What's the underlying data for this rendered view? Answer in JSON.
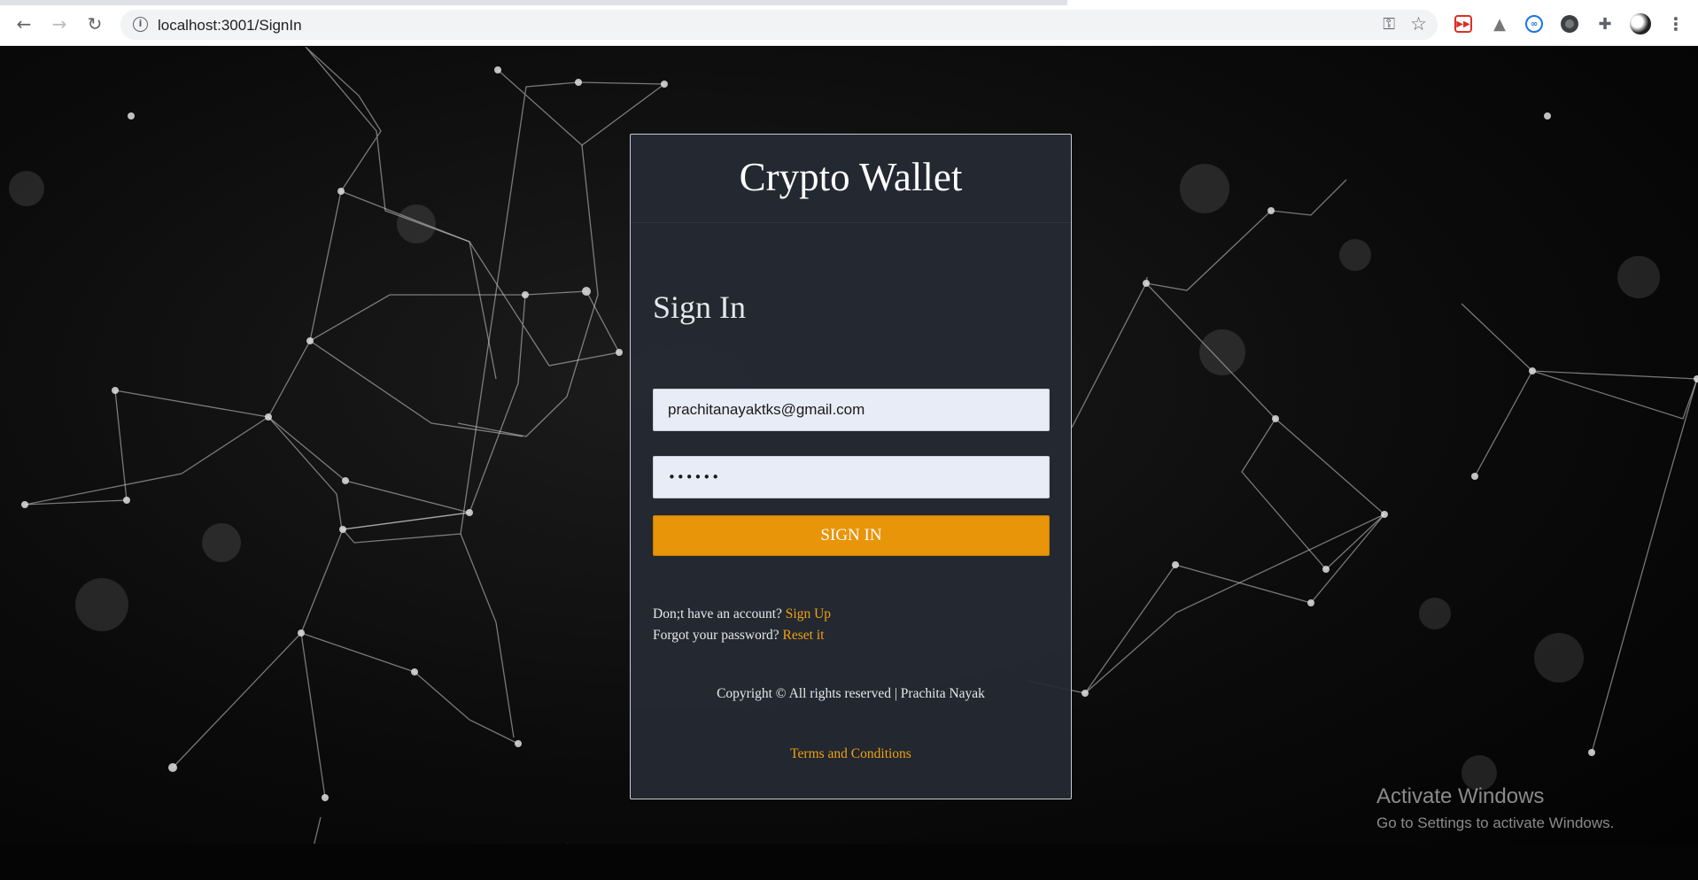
{
  "browser": {
    "back_icon": "arrow-left-icon",
    "forward_icon": "arrow-right-icon",
    "reload_icon": "reload-icon",
    "url": "localhost:3001/SignIn",
    "extensions": [
      "red-extension-icon",
      "drive-icon",
      "loop-extension-icon",
      "dark-extension-icon",
      "puzzle-icon",
      "profile-avatar",
      "kebab-menu-icon"
    ]
  },
  "card": {
    "app_title": "Crypto Wallet",
    "form_title": "Sign In",
    "email_value": "prachitanayaktks@gmail.com",
    "password_value": "••••••",
    "signin_label": "SIGN IN",
    "no_account_text": "Don;t have an account?",
    "signup_link": "Sign Up",
    "forgot_text": "Forgot your password?",
    "reset_link": "Reset it",
    "copyright": "Copyright © All rights reserved | Prachita Nayak",
    "terms_link": "Terms and Conditions"
  },
  "colors": {
    "accent": "#e8950a",
    "link": "#f0a10f",
    "card_bg": "#252a34"
  },
  "watermark": {
    "line1": "Activate Windows",
    "line2": "Go to Settings to activate Windows."
  }
}
